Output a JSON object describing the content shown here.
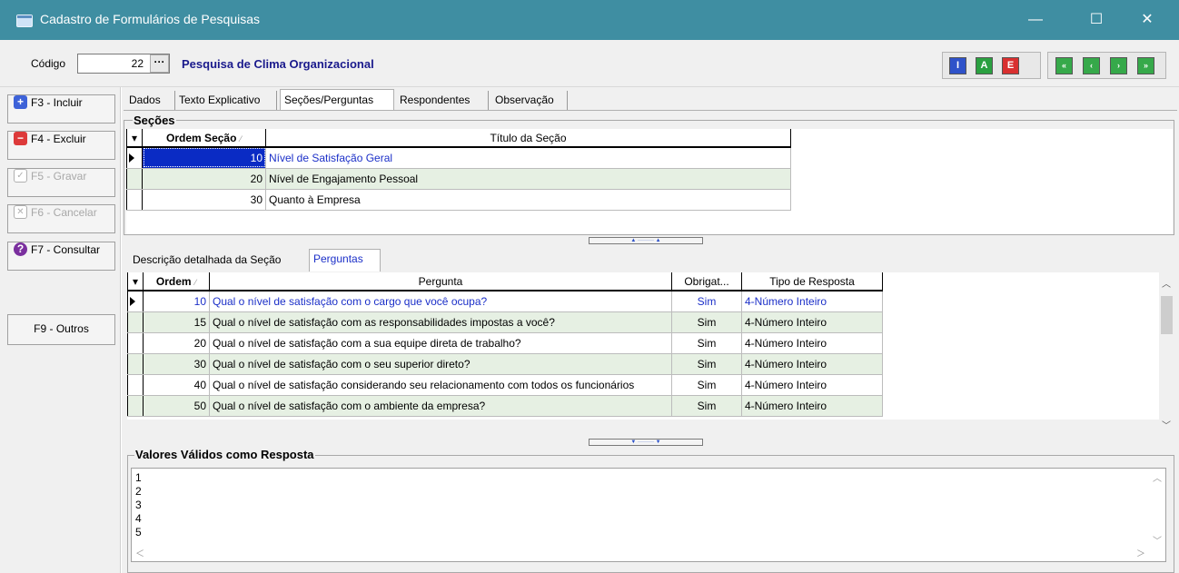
{
  "window": {
    "title": "Cadastro de Formulários de Pesquisas",
    "minimize": "—",
    "maximize": "☐",
    "close": "✕"
  },
  "header": {
    "code_label": "Código",
    "code_value": "22",
    "code_button": "···",
    "survey_name": "Pesquisa de Clima Organizacional",
    "toolbar": [
      "I",
      "A",
      "E"
    ],
    "nav": [
      "«",
      "‹",
      "›",
      "»"
    ]
  },
  "actions": {
    "include": "F3 - Incluir",
    "delete": "F4 - Excluir",
    "save": "F5 - Gravar",
    "cancel": "F6 - Cancelar",
    "query": "F7 - Consultar",
    "others": "F9 - Outros"
  },
  "tabs": [
    "Dados",
    "Texto Explicativo",
    "Seções/Perguntas",
    "Respondentes",
    "Observação"
  ],
  "secoes": {
    "title": "Seções",
    "headers": [
      "Ordem Seção",
      "Título da Seção"
    ],
    "rows": [
      {
        "ordem": "10",
        "titulo": "Nível de Satisfação Geral"
      },
      {
        "ordem": "20",
        "titulo": "Nível de Engajamento Pessoal"
      },
      {
        "ordem": "30",
        "titulo": "Quanto à Empresa"
      }
    ]
  },
  "subtabs": [
    "Descrição detalhada da Seção",
    "Perguntas"
  ],
  "perguntas": {
    "headers": [
      "Ordem",
      "Pergunta",
      "Obrigat...",
      "Tipo de Resposta"
    ],
    "rows": [
      {
        "ordem": "10",
        "pergunta": "Qual o nível de satisfação com o cargo que você ocupa?",
        "obrig": "Sim",
        "tipo": "4-Número Inteiro"
      },
      {
        "ordem": "15",
        "pergunta": "Qual o nível de satisfação com as responsabilidades impostas a você?",
        "obrig": "Sim",
        "tipo": "4-Número Inteiro"
      },
      {
        "ordem": "20",
        "pergunta": "Qual o nível de satisfação com a sua equipe direta de trabalho?",
        "obrig": "Sim",
        "tipo": "4-Número Inteiro"
      },
      {
        "ordem": "30",
        "pergunta": "Qual o nível de satisfação com o seu superior direto?",
        "obrig": "Sim",
        "tipo": "4-Número Inteiro"
      },
      {
        "ordem": "40",
        "pergunta": "Qual o nível de satisfação considerando seu relacionamento com todos os funcionários",
        "obrig": "Sim",
        "tipo": "4-Número Inteiro"
      },
      {
        "ordem": "50",
        "pergunta": "Qual o nível de satisfação com o ambiente da empresa?",
        "obrig": "Sim",
        "tipo": "4-Número Inteiro"
      }
    ]
  },
  "valores": {
    "title": "Valores Válidos como Resposta",
    "lines": [
      "1",
      "2",
      "3",
      "4",
      "5"
    ]
  },
  "colors": {
    "titlebar": "#3f8ea2",
    "selection": "#0a2bc4",
    "link": "#1b2fc8",
    "alt_row": "#e6f0e3"
  }
}
